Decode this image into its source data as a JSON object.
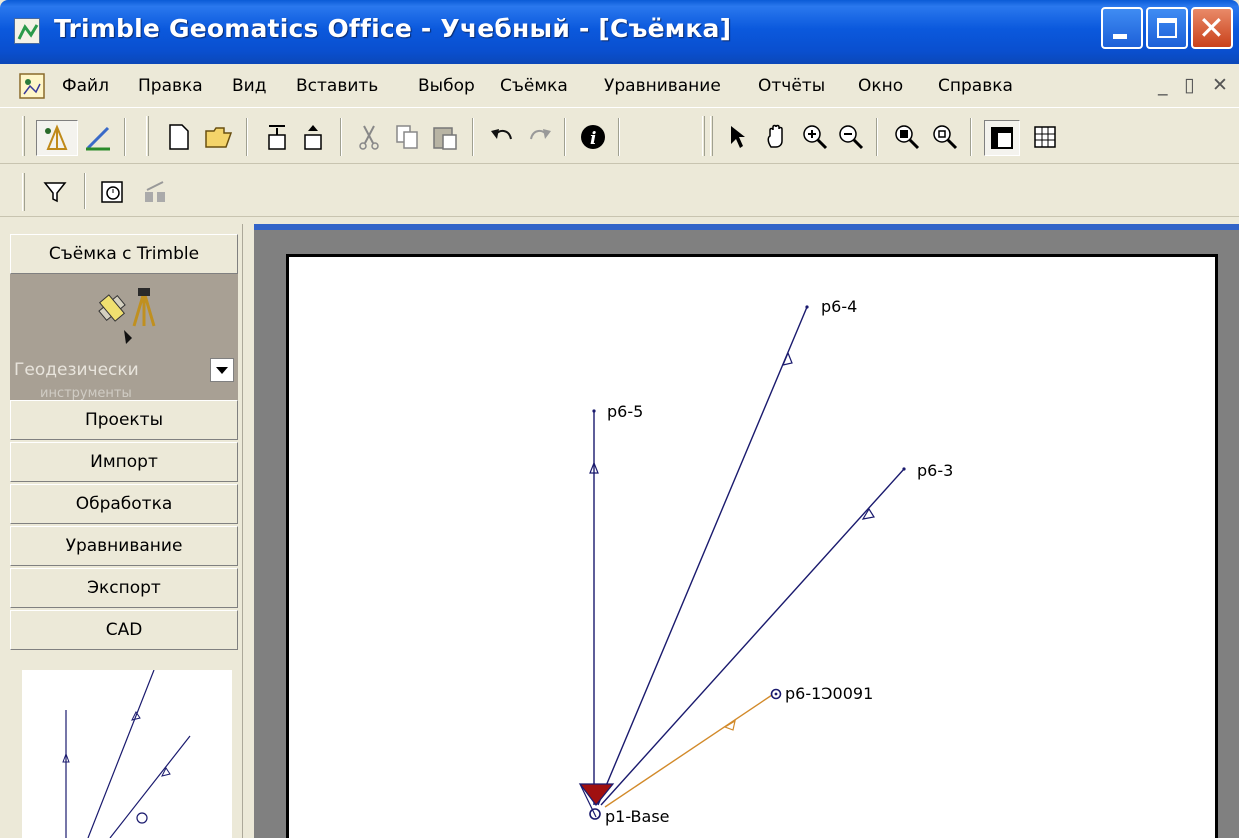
{
  "window": {
    "title": "Trimble Geomatics Office  - Учебный - [Съёмка]",
    "min_label": "minimize",
    "max_label": "maximize",
    "close_glyph": "✕"
  },
  "menu": {
    "items": [
      "Файл",
      "Правка",
      "Вид",
      "Вставить",
      "Выбор",
      "Съёмка",
      "Уравнивание",
      "Отчёты",
      "Окно",
      "Справка"
    ],
    "mdi_min": "_",
    "mdi_restore": "▯",
    "mdi_close": "✕"
  },
  "toolbar": {
    "icons": [
      "survey-icon",
      "pen-icon",
      "new-icon",
      "open-icon",
      "import-icon",
      "export-icon",
      "cut-icon",
      "copy-icon",
      "paste-icon",
      "undo-icon",
      "redo-icon",
      "info-icon",
      "select-icon",
      "pan-icon",
      "zoom-in-icon",
      "zoom-out-icon",
      "zoom-extents-icon",
      "zoom-window-icon",
      "plan-view-icon",
      "grid-icon"
    ],
    "icons2": [
      "filter-icon",
      "timeline-icon",
      "network-icon"
    ]
  },
  "left_panel": {
    "header": "Съёмка с Trimble",
    "instruments_label": "Геодезически",
    "instruments_label_cut": "инструменты",
    "items": [
      "Проекты",
      "Импорт",
      "Обработка",
      "Уравнивание",
      "Экспорт",
      "CAD"
    ]
  },
  "survey": {
    "points": [
      {
        "name": "p6-4"
      },
      {
        "name": "p6-5"
      },
      {
        "name": "p6-3"
      },
      {
        "name": "p6-1Ɔ0091"
      },
      {
        "name": "p1-Base"
      }
    ],
    "colors": {
      "vector": "#1a1a6e",
      "orange_vector": "#d28a2a",
      "base_marker": "#a01010",
      "panel_dark": "#a8a094",
      "title_blue": "#0a55d6"
    }
  }
}
